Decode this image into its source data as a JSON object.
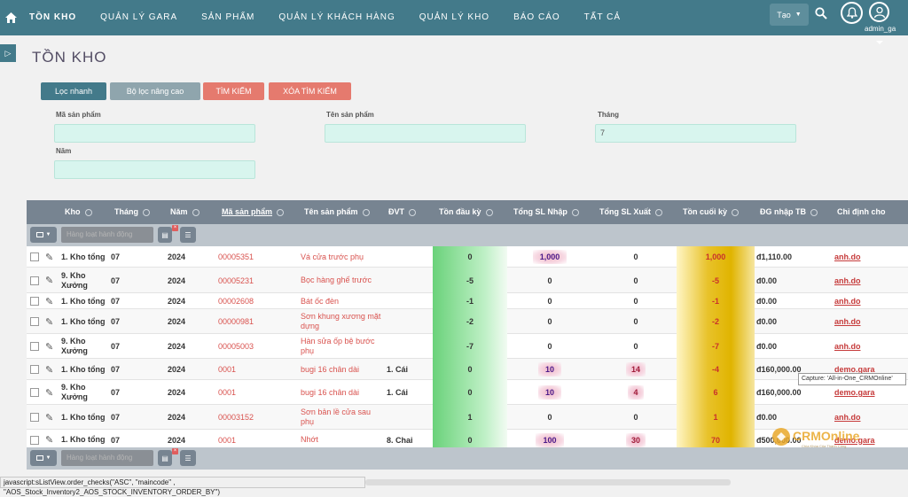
{
  "nav": {
    "items": [
      "TỒN KHO",
      "QUẢN LÝ GARA",
      "SẢN PHẨM",
      "QUẢN LÝ KHÁCH HÀNG",
      "QUẢN LÝ KHO",
      "BÁO CÁO",
      "TẤT CẢ"
    ],
    "create_label": "Tạo",
    "user_name": "admin_ga"
  },
  "page": {
    "title": "TỒN KHO"
  },
  "tabs": {
    "quick": "Lọc nhanh",
    "advanced": "Bộ lọc nâng cao",
    "search": "TÌM KIẾM",
    "clear": "XÓA TÌM KIẾM"
  },
  "filters": {
    "ma_sp_label": "Mã sản phẩm",
    "ma_sp_value": "",
    "ten_sp_label": "Tên sản phẩm",
    "ten_sp_value": "",
    "thang_label": "Tháng",
    "thang_value": "7",
    "nam_label": "Năm",
    "nam_value": ""
  },
  "table": {
    "columns": [
      "Kho",
      "Tháng",
      "Năm",
      "Mã sản phẩm",
      "Tên sản phẩm",
      "ĐVT",
      "Tồn đầu kỳ",
      "Tổng SL Nhập",
      "Tổng SL Xuất",
      "Tồn cuối kỳ",
      "ĐG nhập TB",
      "Chỉ định cho"
    ],
    "mass_action_label": "Hàng loạt hành động",
    "rows": [
      {
        "kho": "1. Kho tổng",
        "thang": "07",
        "nam": "2024",
        "ma": "00005351",
        "ten": "Vá cửa trước phụ",
        "dvt": "",
        "ton_dau": "0",
        "nhap": "1,000",
        "xuat": "0",
        "ton_cuoi": "1,000",
        "dg": "đ1,110.00",
        "assign": "anh.do"
      },
      {
        "kho": "9. Kho Xưởng",
        "thang": "07",
        "nam": "2024",
        "ma": "00005231",
        "ten": "Bọc hàng ghế trước",
        "dvt": "",
        "ton_dau": "-5",
        "nhap": "0",
        "xuat": "0",
        "ton_cuoi": "-5",
        "dg": "đ0.00",
        "assign": "anh.do"
      },
      {
        "kho": "1. Kho tổng",
        "thang": "07",
        "nam": "2024",
        "ma": "00002608",
        "ten": "Bát ốc đèn",
        "dvt": "",
        "ton_dau": "-1",
        "nhap": "0",
        "xuat": "0",
        "ton_cuoi": "-1",
        "dg": "đ0.00",
        "assign": "anh.do"
      },
      {
        "kho": "1. Kho tổng",
        "thang": "07",
        "nam": "2024",
        "ma": "00000981",
        "ten": "Sơn khung xương mặt dựng",
        "dvt": "",
        "ton_dau": "-2",
        "nhap": "0",
        "xuat": "0",
        "ton_cuoi": "-2",
        "dg": "đ0.00",
        "assign": "anh.do"
      },
      {
        "kho": "9. Kho Xưởng",
        "thang": "07",
        "nam": "2024",
        "ma": "00005003",
        "ten": "Hàn sửa ốp bệ bước phụ",
        "dvt": "",
        "ton_dau": "-7",
        "nhap": "0",
        "xuat": "0",
        "ton_cuoi": "-7",
        "dg": "đ0.00",
        "assign": "anh.do"
      },
      {
        "kho": "1. Kho tổng",
        "thang": "07",
        "nam": "2024",
        "ma": "0001",
        "ten": "bugi 16 chân dài",
        "dvt": "1. Cái",
        "ton_dau": "0",
        "nhap": "10",
        "xuat": "14",
        "ton_cuoi": "-4",
        "dg": "đ160,000.00",
        "assign": "demo.gara"
      },
      {
        "kho": "9. Kho Xưởng",
        "thang": "07",
        "nam": "2024",
        "ma": "0001",
        "ten": "bugi 16 chân dài",
        "dvt": "1. Cái",
        "ton_dau": "0",
        "nhap": "10",
        "xuat": "4",
        "ton_cuoi": "6",
        "dg": "đ160,000.00",
        "assign": "demo.gara"
      },
      {
        "kho": "1. Kho tổng",
        "thang": "07",
        "nam": "2024",
        "ma": "00003152",
        "ten": "Sơn bản lề cửa sau phụ",
        "dvt": "",
        "ton_dau": "1",
        "nhap": "0",
        "xuat": "0",
        "ton_cuoi": "1",
        "dg": "đ0.00",
        "assign": "anh.do"
      },
      {
        "kho": "1. Kho tổng",
        "thang": "07",
        "nam": "2024",
        "ma": "0001",
        "ten": "Nhớt",
        "dvt": "8. Chai",
        "ton_dau": "0",
        "nhap": "100",
        "xuat": "30",
        "ton_cuoi": "70",
        "dg": "đ500,000.00",
        "assign": "demo.gara"
      }
    ]
  },
  "tooltip": "Capture: 'All-in-One_CRMOnline'",
  "status_bar": "javascript:sListView.order_checks(\"ASC\", \"maincode\" , \"AOS_Stock_Inventory2_AOS_STOCK_INVENTORY_ORDER_BY\")",
  "watermark": {
    "brand": "CRMOnline",
    "tagline": "Chìa Khóa Của Thành Công"
  },
  "colors": {
    "nav": "#437a8a",
    "header": "#778491",
    "green": "#6ad27a",
    "gold": "#e0b400",
    "pink": "#f0b7c9"
  }
}
